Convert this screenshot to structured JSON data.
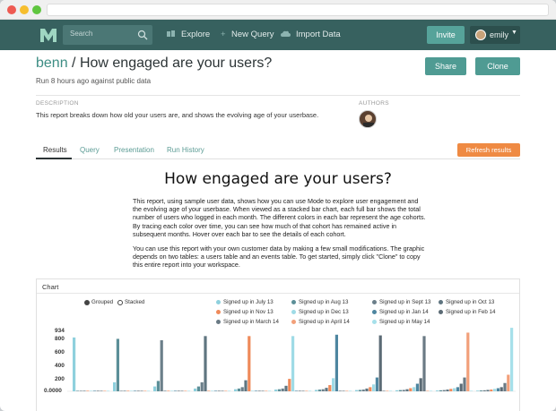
{
  "nav": {
    "search_placeholder": "Search",
    "links": [
      "Explore",
      "New Query",
      "Import Data"
    ],
    "invite_label": "Invite",
    "user_name": "emily"
  },
  "report": {
    "org": "benn",
    "separator": " / ",
    "title": "How engaged are your users?",
    "run_info": "Run 8 hours ago against public data",
    "share_label": "Share",
    "clone_label": "Clone",
    "description_heading": "DESCRIPTION",
    "description": "This report breaks down how old your users are, and shows the evolving age of your userbase.",
    "authors_heading": "AUTHORS"
  },
  "tabs": [
    "Results",
    "Query",
    "Presentation",
    "Run History"
  ],
  "refresh_label": "Refresh results",
  "body": {
    "heading": "How engaged are your users?",
    "paragraph1": "This report, using sample user data, shows how you can use Mode to explore user engagement and the evolving age of your userbase. When viewed as a stacked bar chart, each full bar shows the total number of users who logged in each month. The different colors in each bar represent the age cohorts. By tracing each color over time, you can see how much of that cohort has remained active in subsequent months. Hover over each bar to see the details of each cohort.",
    "paragraph2": "You can use this report with your own customer data by making a few small modifications. The graphic depends on two tables: a users table and an events table. To get started, simply click \"Clone\" to copy this entire report into your workspace."
  },
  "chart_card_title": "Chart",
  "chart_data": {
    "type": "bar",
    "mode_options": [
      "Grouped",
      "Stacked"
    ],
    "mode_selected": "Grouped",
    "ylim": [
      0,
      934
    ],
    "yticks": [
      "934",
      "800",
      "600",
      "400",
      "200",
      "0.0000"
    ],
    "series": [
      {
        "name": "Signed up in July 13",
        "color": "#8ed0dd"
      },
      {
        "name": "Signed up in Aug 13",
        "color": "#5c8f98"
      },
      {
        "name": "Signed up in Sept 13",
        "color": "#6b7f8a"
      },
      {
        "name": "Signed up in Oct 13",
        "color": "#5f7580"
      },
      {
        "name": "Signed up in Nov 13",
        "color": "#ef8a5a"
      },
      {
        "name": "Signed up in Dec 13",
        "color": "#9fdbe6"
      },
      {
        "name": "Signed up in Jan 14",
        "color": "#4e86a0"
      },
      {
        "name": "Signed up in Feb 14",
        "color": "#5b6b75"
      },
      {
        "name": "Signed up in March 14",
        "color": "#6a7a84"
      },
      {
        "name": "Signed up in April 14",
        "color": "#f2a07a"
      },
      {
        "name": "Signed up in May 14",
        "color": "#a6e0ea"
      }
    ],
    "groups": [
      [
        780,
        0,
        0,
        0,
        0,
        0,
        0,
        0,
        0,
        0,
        0
      ],
      [
        130,
        760,
        0,
        0,
        0,
        0,
        0,
        0,
        0,
        0,
        0
      ],
      [
        70,
        150,
        740,
        0,
        0,
        0,
        0,
        0,
        0,
        0,
        0
      ],
      [
        40,
        70,
        130,
        800,
        0,
        0,
        0,
        0,
        0,
        0,
        0
      ],
      [
        30,
        40,
        60,
        160,
        800,
        0,
        0,
        0,
        0,
        0,
        0
      ],
      [
        25,
        30,
        40,
        80,
        180,
        800,
        0,
        0,
        0,
        0,
        0
      ],
      [
        20,
        25,
        30,
        50,
        90,
        190,
        820,
        0,
        0,
        0,
        0
      ],
      [
        18,
        20,
        25,
        40,
        60,
        100,
        200,
        810,
        0,
        0,
        0
      ],
      [
        15,
        18,
        20,
        30,
        45,
        60,
        110,
        190,
        800,
        0,
        0
      ],
      [
        12,
        15,
        18,
        25,
        35,
        45,
        60,
        110,
        200,
        850,
        0
      ],
      [
        10,
        12,
        15,
        20,
        25,
        35,
        45,
        60,
        120,
        240,
        920
      ]
    ]
  }
}
